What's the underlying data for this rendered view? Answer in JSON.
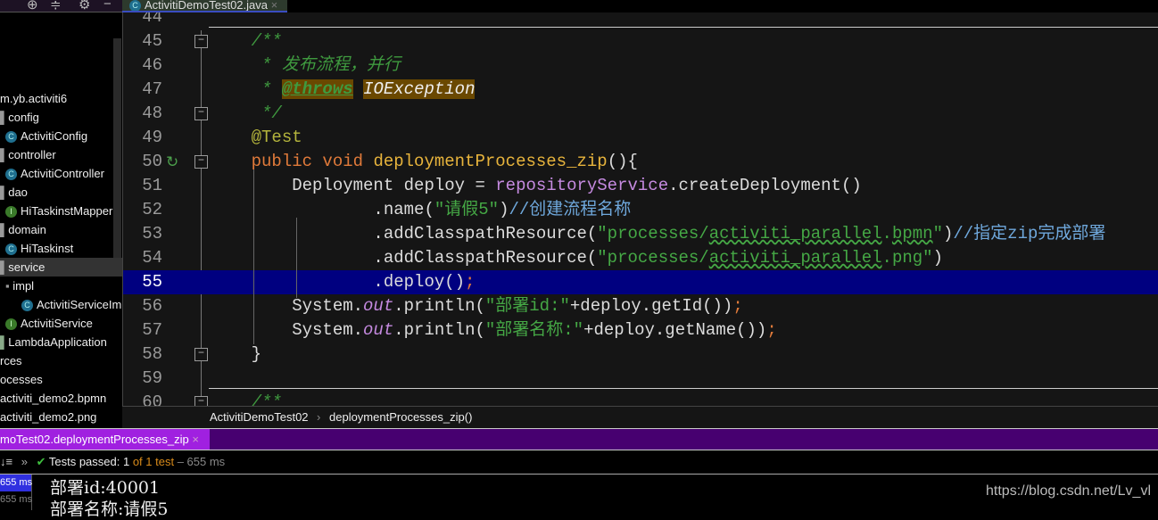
{
  "toolbar": {
    "icons": [
      "target-icon",
      "collapse-icon",
      "gear-icon",
      "minimize-icon"
    ]
  },
  "editor_tab": {
    "label": "ActivitiDemoTest02.java",
    "close": "×",
    "icon": "C"
  },
  "sidebar": {
    "items": [
      {
        "label": "m.yb.activiti6",
        "indent": 0,
        "icon": ""
      },
      {
        "label": "config",
        "indent": 0,
        "icon": "folder"
      },
      {
        "label": "ActivitiConfig",
        "indent": 1,
        "icon": "C"
      },
      {
        "label": "controller",
        "indent": 0,
        "icon": "folder"
      },
      {
        "label": "ActivitiController",
        "indent": 1,
        "icon": "C"
      },
      {
        "label": "dao",
        "indent": 0,
        "icon": "folder"
      },
      {
        "label": "HiTaskinstMapper",
        "indent": 1,
        "icon": "I"
      },
      {
        "label": "domain",
        "indent": 0,
        "icon": "folder"
      },
      {
        "label": "HiTaskinst",
        "indent": 1,
        "icon": "C"
      },
      {
        "label": "service",
        "indent": 0,
        "icon": "folder",
        "selected": true
      },
      {
        "label": "impl",
        "indent": 1,
        "icon": "folder"
      },
      {
        "label": "ActivitiServiceImpl",
        "indent": 2,
        "icon": "C"
      },
      {
        "label": "ActivitiService",
        "indent": 1,
        "icon": "I"
      },
      {
        "label": "LambdaApplication",
        "indent": 0,
        "icon": "app"
      },
      {
        "label": "rces",
        "indent": 0,
        "icon": ""
      },
      {
        "label": "ocesses",
        "indent": 0,
        "icon": ""
      },
      {
        "label": "activiti_demo2.bpmn",
        "indent": 0,
        "icon": ""
      },
      {
        "label": "activiti_demo2.png",
        "indent": 0,
        "icon": ""
      }
    ]
  },
  "code": {
    "highlighted_line": 55,
    "lines": [
      {
        "n": "44",
        "tokens": []
      },
      {
        "n": "45",
        "fold": true,
        "tokens": [
          {
            "t": "    /**",
            "c": "cm"
          }
        ]
      },
      {
        "n": "46",
        "tokens": [
          {
            "t": "     * 发布流程，并行",
            "c": "cm"
          }
        ]
      },
      {
        "n": "47",
        "tokens": [
          {
            "t": "     * ",
            "c": "cm"
          },
          {
            "t": "@throws",
            "c": "tag"
          },
          {
            "t": " ",
            "c": "cm"
          },
          {
            "t": "IOException",
            "c": "tagv"
          }
        ]
      },
      {
        "n": "48",
        "fold": true,
        "tokens": [
          {
            "t": "     */",
            "c": "cm"
          }
        ]
      },
      {
        "n": "49",
        "tokens": [
          {
            "t": "    @Test",
            "c": "ann"
          }
        ]
      },
      {
        "n": "50",
        "fold": true,
        "run": true,
        "tokens": [
          {
            "t": "    public void ",
            "c": "kw"
          },
          {
            "t": "deploymentProcesses_zip",
            "c": "fn"
          },
          {
            "t": "(){",
            "c": "tx"
          }
        ]
      },
      {
        "n": "51",
        "tokens": [
          {
            "t": "        Deployment deploy = ",
            "c": "tx"
          },
          {
            "t": "repositoryService",
            "c": "fld"
          },
          {
            "t": ".createDeployment()",
            "c": "tx"
          }
        ]
      },
      {
        "n": "52",
        "tokens": [
          {
            "t": "                .name(",
            "c": "tx"
          },
          {
            "t": "\"请假5\"",
            "c": "str"
          },
          {
            "t": ")",
            "c": "tx"
          },
          {
            "t": "//创建流程名称",
            "c": "lc"
          }
        ]
      },
      {
        "n": "53",
        "tokens": [
          {
            "t": "                .addClasspathResource(",
            "c": "tx"
          },
          {
            "t": "\"processes/",
            "c": "str"
          },
          {
            "t": "activiti_parallel",
            "c": "strw"
          },
          {
            "t": ".",
            "c": "str"
          },
          {
            "t": "bpmn",
            "c": "strw"
          },
          {
            "t": "\"",
            "c": "str"
          },
          {
            "t": ")",
            "c": "tx"
          },
          {
            "t": "//指定zip完成部署",
            "c": "lc"
          }
        ]
      },
      {
        "n": "54",
        "tokens": [
          {
            "t": "                .addClasspathResource(",
            "c": "tx"
          },
          {
            "t": "\"processes/",
            "c": "str"
          },
          {
            "t": "activiti_parallel",
            "c": "strw"
          },
          {
            "t": ".png\"",
            "c": "str"
          },
          {
            "t": ")",
            "c": "tx"
          }
        ]
      },
      {
        "n": "55",
        "tokens": [
          {
            "t": "                .deploy()",
            "c": "tx"
          },
          {
            "t": ";",
            "c": "semi"
          }
        ]
      },
      {
        "n": "56",
        "tokens": [
          {
            "t": "        System.",
            "c": "tx"
          },
          {
            "t": "out",
            "c": "st"
          },
          {
            "t": ".println(",
            "c": "tx"
          },
          {
            "t": "\"部署id:\"",
            "c": "str"
          },
          {
            "t": "+deploy.getId())",
            "c": "tx"
          },
          {
            "t": ";",
            "c": "semi"
          }
        ]
      },
      {
        "n": "57",
        "tokens": [
          {
            "t": "        System.",
            "c": "tx"
          },
          {
            "t": "out",
            "c": "st"
          },
          {
            "t": ".println(",
            "c": "tx"
          },
          {
            "t": "\"部署名称:\"",
            "c": "str"
          },
          {
            "t": "+deploy.getName())",
            "c": "tx"
          },
          {
            "t": ";",
            "c": "semi"
          }
        ]
      },
      {
        "n": "58",
        "fold": true,
        "tokens": [
          {
            "t": "    }",
            "c": "tx"
          }
        ]
      },
      {
        "n": "59",
        "tokens": []
      },
      {
        "n": "60",
        "fold": true,
        "tokens": [
          {
            "t": "    /**",
            "c": "cm"
          }
        ]
      }
    ]
  },
  "breadcrumb": {
    "class": "ActivitiDemoTest02",
    "sep": "›",
    "method": "deploymentProcesses_zip()"
  },
  "run": {
    "tab_label": "moTest02.deploymentProcesses_zip",
    "close": "×"
  },
  "status": {
    "sort_icon": "↓≡",
    "expand": "»",
    "check": "✔",
    "passed_label": "Tests passed: ",
    "passed_count": "1",
    "of_text": " of 1 test",
    "duration": " – 655 ms"
  },
  "console": {
    "times": [
      "655 ms",
      "655 ms"
    ],
    "output": [
      "部署id:40001",
      "部署名称:请假5"
    ]
  },
  "watermark": "https://blog.csdn.net/Lv_vl"
}
